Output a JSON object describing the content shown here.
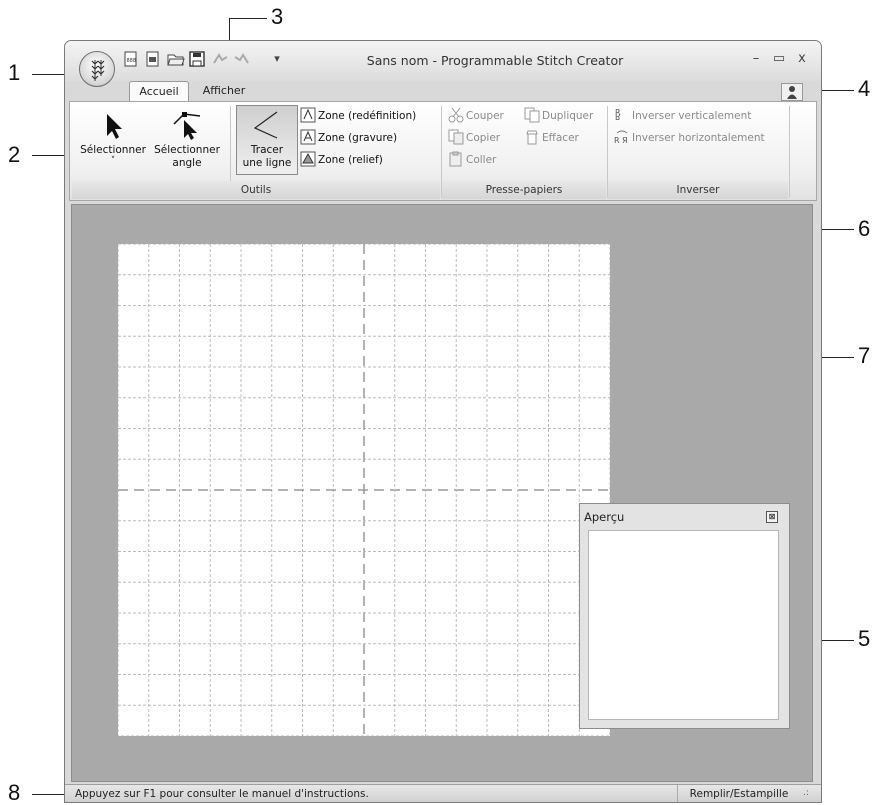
{
  "window": {
    "title": "Sans nom - Programmable Stitch Creator",
    "minimize_glyph": "–",
    "maximize_glyph": "▭",
    "close_glyph": "x"
  },
  "quick_access": [
    "new-icon",
    "new-template-icon",
    "open-icon",
    "save-icon",
    "undo-icon",
    "redo-icon"
  ],
  "quick_access_menu_glyph": "▾",
  "tabs": [
    {
      "label": "Accueil",
      "selected": true
    },
    {
      "label": "Afficher",
      "selected": false
    }
  ],
  "ribbon": {
    "groups": {
      "outils": "Outils",
      "presse_papiers": "Presse-papiers",
      "inverser": "Inverser"
    },
    "select_label": "Sélectionner",
    "select_arrow": "˅",
    "select_angle_label_1": "Sélectionner",
    "select_angle_label_2": "angle",
    "draw_line_label_1": "Tracer",
    "draw_line_label_2": "une ligne",
    "zone_redefinition": "Zone (redéfinition)",
    "zone_gravure": "Zone (gravure)",
    "zone_relief": "Zone (relief)",
    "couper": "Couper",
    "dupliquer": "Dupliquer",
    "copier": "Copier",
    "effacer": "Effacer",
    "coller": "Coller",
    "inverser_vert": "Inverser verticalement",
    "inverser_horiz": "Inverser horizontalement"
  },
  "preview": {
    "title": "Aperçu",
    "close_glyph": "⊠"
  },
  "statusbar": {
    "help_text": "Appuyez sur F1 pour consulter le manuel d'instructions.",
    "mode": "Remplir/Estampille",
    "grip": ".:"
  },
  "callouts": [
    "1",
    "2",
    "3",
    "4",
    "5",
    "6",
    "7",
    "8"
  ],
  "colors": {
    "workspace": "#a9a9a9",
    "grid_background": "#ffffff",
    "grid_line": "#bdbdbd"
  }
}
